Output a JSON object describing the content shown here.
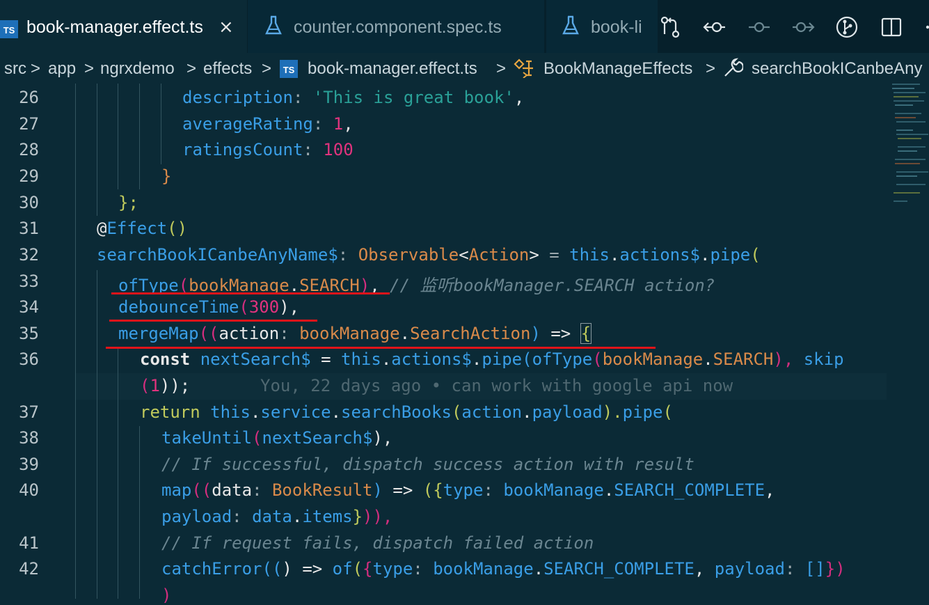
{
  "tabs": [
    {
      "label": "book-manager.effect.ts",
      "icon": "ts-file-icon",
      "active": true,
      "close": "×"
    },
    {
      "label": "counter.component.spec.ts",
      "icon": "flask-icon",
      "active": false
    },
    {
      "label": "book-li",
      "icon": "flask-icon",
      "active": false
    }
  ],
  "ts_badge": "TS",
  "editor_actions": [
    "open-changes-icon",
    "previous-change-icon",
    "go-to-current-icon",
    "next-change-icon",
    "git-graph-icon",
    "split-editor-icon",
    "more-actions-icon"
  ],
  "breadcrumb": {
    "items": [
      "src",
      "app",
      "ngrxdemo",
      "effects",
      "book-manager.effect.ts",
      "BookManageEffects",
      "searchBookICanbeAny"
    ],
    "separator": ">"
  },
  "editor": {
    "line_numbers": [
      "26",
      "27",
      "28",
      "29",
      "30",
      "31",
      "32",
      "33",
      "34",
      "35",
      "36",
      "37",
      "38",
      "39",
      "40",
      "41",
      "42"
    ],
    "lines": {
      "l26": [
        "description",
        ": ",
        "'This is great book'",
        ","
      ],
      "l27": [
        "averageRating",
        ": ",
        "1",
        ","
      ],
      "l28": [
        "ratingsCount",
        ": ",
        "100"
      ],
      "l29": [
        "}"
      ],
      "l30": [
        "};"
      ],
      "l31": [
        "@",
        "Effect",
        "()"
      ],
      "l32": [
        "searchBookICanbeAnyName$",
        ": ",
        "Observable",
        "<",
        "Action",
        ">",
        " = ",
        "this",
        ".",
        "actions$",
        ".",
        "pipe",
        "("
      ],
      "l33": [
        "ofType",
        "(",
        "bookManage",
        ".",
        "SEARCH",
        ")",
        ", ",
        "// 监听bookManager.SEARCH action?"
      ],
      "l34": [
        "debounceTime",
        "(",
        "300",
        "),"
      ],
      "l35": [
        "mergeMap",
        "((",
        "action",
        ": ",
        "bookManage",
        ".",
        "SearchAction",
        ") ",
        "=>",
        " ",
        "{"
      ],
      "l36": [
        "const",
        " ",
        "nextSearch$",
        " = ",
        "this",
        ".",
        "actions$",
        ".",
        "pipe",
        "(",
        "ofType",
        "(",
        "bookManage",
        ".",
        "SEARCH",
        "), ",
        "skip"
      ],
      "l36b": [
        "(",
        "1",
        "));"
      ],
      "blame": "You, 22 days ago • can work with google api now",
      "l37": [
        "return",
        " ",
        "this",
        ".",
        "service",
        ".",
        "searchBooks",
        "(",
        "action",
        ".",
        "payload",
        ").",
        "pipe",
        "("
      ],
      "l38": [
        "takeUntil",
        "(",
        "nextSearch$",
        "),"
      ],
      "l39": [
        "// If successful, dispatch success action with result"
      ],
      "l40": [
        "map",
        "((",
        "data",
        ": ",
        "BookResult",
        ") ",
        "=>",
        " (",
        "{",
        "type",
        ": ",
        "bookManage",
        ".",
        "SEARCH_COMPLETE",
        ","
      ],
      "l40b": [
        "payload",
        ": ",
        "data",
        ".",
        "items",
        "}",
        ")),"
      ],
      "l41": [
        "// If request fails, dispatch failed action"
      ],
      "l42": [
        "catchError",
        "((",
        ") ",
        "=>",
        " ",
        "of",
        "(",
        "{",
        "type",
        ": ",
        "bookManage",
        ".",
        "SEARCH_COMPLETE",
        ", ",
        "payload",
        ": ",
        "[]",
        "})"
      ],
      "l42b": [
        ")"
      ]
    }
  },
  "colors": {
    "background": "#0b2a36",
    "tabbar": "#06202b",
    "keyword": "#c0ca5c",
    "type": "#d98a4a",
    "function": "#3a9ee6",
    "string": "#2aa198",
    "number": "#e0337d",
    "comment": "#6a8590",
    "underline": "#e0141a"
  }
}
